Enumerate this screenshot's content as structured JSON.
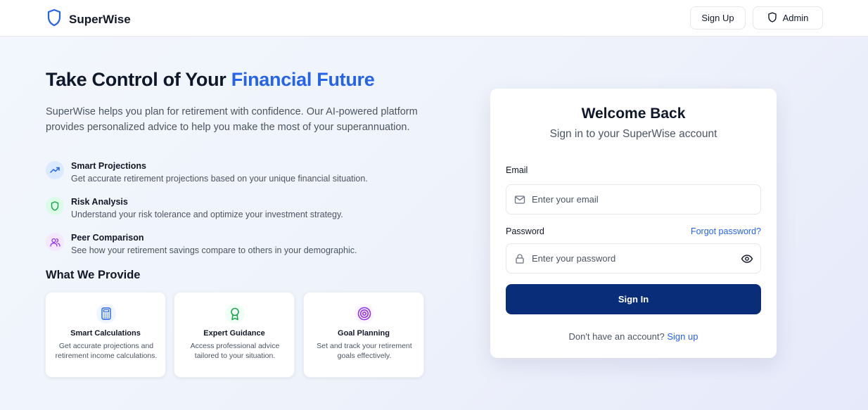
{
  "header": {
    "brand": "SuperWise",
    "signup_label": "Sign Up",
    "admin_label": "Admin"
  },
  "hero": {
    "title_part1": "Take Control of Your ",
    "title_accent": "Financial Future",
    "description": "SuperWise helps you plan for retirement with confidence. Our AI-powered platform provides personalized advice to help you make the most of your superannuation."
  },
  "features": [
    {
      "icon": "trend-up-icon",
      "title": "Smart Projections",
      "description": "Get accurate retirement projections based on your unique financial situation."
    },
    {
      "icon": "shield-icon",
      "title": "Risk Analysis",
      "description": "Understand your risk tolerance and optimize your investment strategy."
    },
    {
      "icon": "users-icon",
      "title": "Peer Comparison",
      "description": "See how your retirement savings compare to others in your demographic."
    }
  ],
  "provide": {
    "title": "What We Provide",
    "cards": [
      {
        "icon": "calculator-icon",
        "title": "Smart Calculations",
        "description": "Get accurate projections and retirement income calculations."
      },
      {
        "icon": "award-icon",
        "title": "Expert Guidance",
        "description": "Access professional advice tailored to your situation."
      },
      {
        "icon": "target-icon",
        "title": "Goal Planning",
        "description": "Set and track your retirement goals effectively."
      }
    ]
  },
  "login": {
    "title": "Welcome Back",
    "subtitle": "Sign in to your SuperWise account",
    "email_label": "Email",
    "email_placeholder": "Enter your email",
    "email_value": "",
    "password_label": "Password",
    "forgot_label": "Forgot password?",
    "password_placeholder": "Enter your password",
    "password_value": "",
    "submit_label": "Sign In",
    "no_account_text": "Don't have an account? ",
    "signup_link": "Sign up"
  },
  "colors": {
    "accent": "#2563eb",
    "primary_button": "#0a2d7a",
    "green": "#16a34a",
    "purple": "#9333ea"
  }
}
